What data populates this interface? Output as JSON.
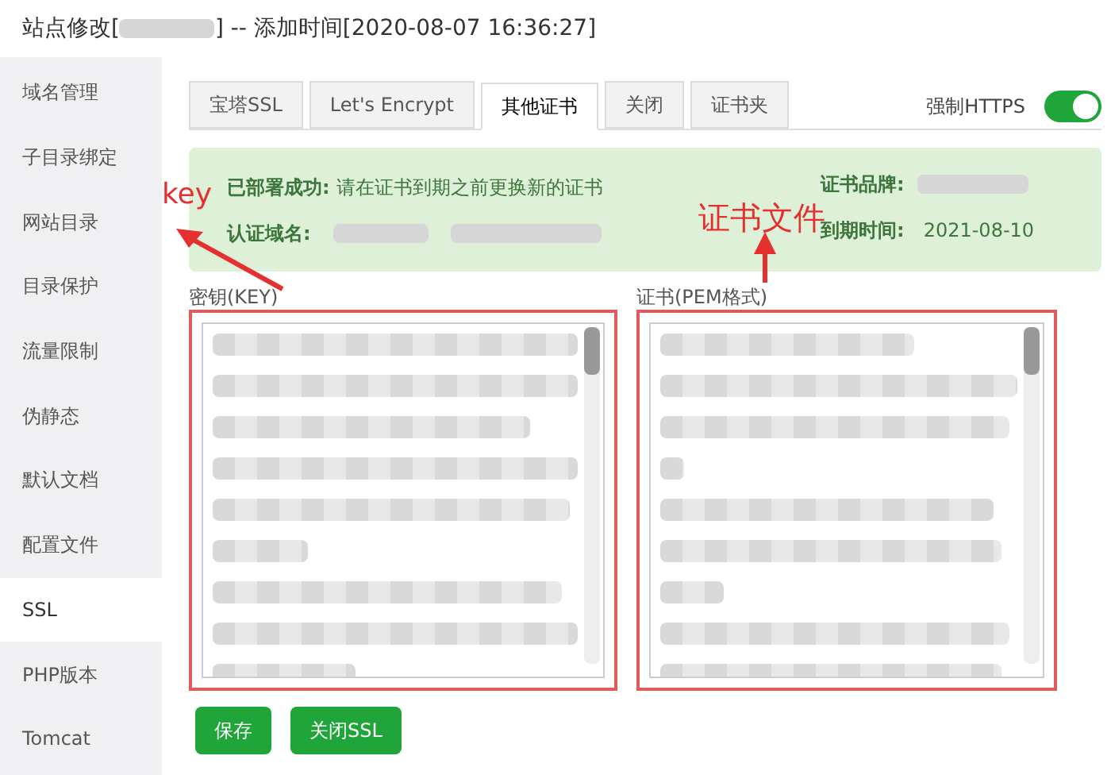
{
  "window": {
    "title_prefix": "站点修改[",
    "title_suffix": "] -- 添加时间[2020-08-07 16:36:27]"
  },
  "sidebar": {
    "items": [
      {
        "label": "域名管理",
        "selected": false
      },
      {
        "label": "子目录绑定",
        "selected": false
      },
      {
        "label": "网站目录",
        "selected": false
      },
      {
        "label": "目录保护",
        "selected": false
      },
      {
        "label": "流量限制",
        "selected": false
      },
      {
        "label": "伪静态",
        "selected": false
      },
      {
        "label": "默认文档",
        "selected": false
      },
      {
        "label": "配置文件",
        "selected": false
      },
      {
        "label": "SSL",
        "selected": true
      },
      {
        "label": "PHP版本",
        "selected": false
      },
      {
        "label": "Tomcat",
        "selected": false
      }
    ]
  },
  "tabs": [
    {
      "label": "宝塔SSL",
      "selected": false
    },
    {
      "label": "Let's Encrypt",
      "selected": false
    },
    {
      "label": "其他证书",
      "selected": true
    },
    {
      "label": "关闭",
      "selected": false
    },
    {
      "label": "证书夹",
      "selected": false
    }
  ],
  "force_https": {
    "label": "强制HTTPS",
    "on": true
  },
  "status": {
    "deployed_label": "已部署成功:",
    "deployed_text": "请在证书到期之前更换新的证书",
    "domain_label": "认证域名:",
    "brand_label": "证书品牌:",
    "expiry_label": "到期时间:",
    "expiry_value": "2021-08-10"
  },
  "key_field": {
    "label": "密钥(KEY)"
  },
  "cert_field": {
    "label": "证书(PEM格式)"
  },
  "buttons": [
    {
      "label": "保存"
    },
    {
      "label": "关闭SSL"
    }
  ],
  "annotations": [
    {
      "text": "key"
    },
    {
      "text": "证书文件"
    }
  ]
}
